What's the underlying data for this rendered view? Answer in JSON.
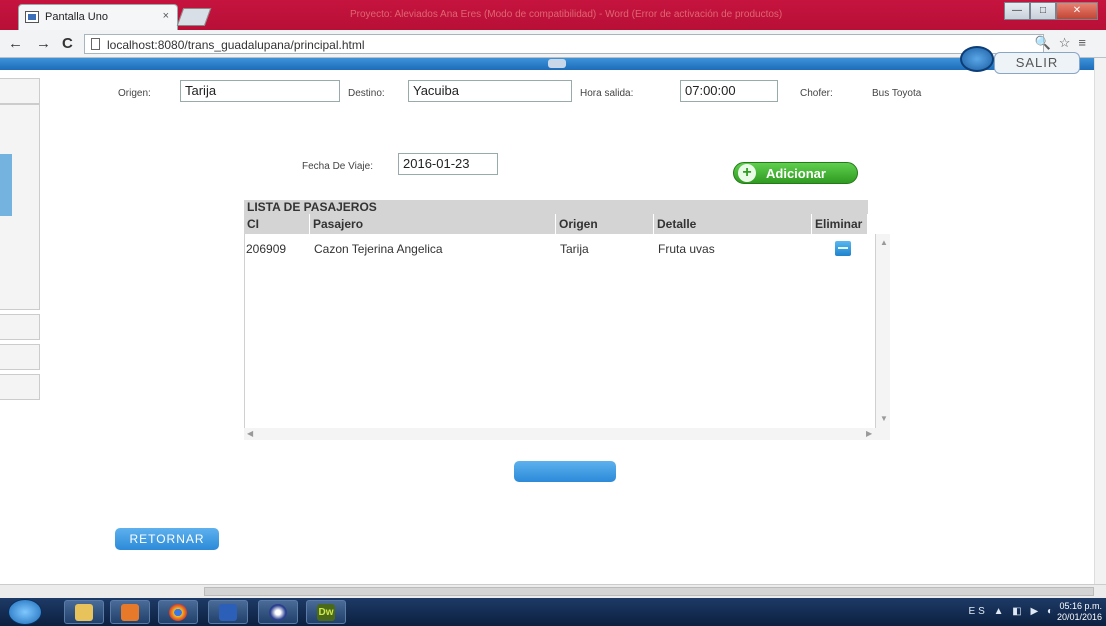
{
  "browser": {
    "tab_title": "Pantalla Uno",
    "tab_close": "×",
    "window_title": "Proyecto: Aleviados Ana Eres (Modo de compatibilidad) - Word (Error de activación de productos)",
    "url": "localhost:8080/trans_guadalupana/principal.html",
    "win_buttons": {
      "minimize": "—",
      "maximize": "□",
      "close": "✕"
    },
    "nav": {
      "back": "←",
      "forward": "→",
      "reload": "C"
    },
    "addr_icons": "🔍☆≡"
  },
  "header": {
    "salir_label": "SALIR"
  },
  "form": {
    "origen_label": "Origen:",
    "origen_value": "Tarija",
    "destino_label": "Destino:",
    "destino_value": "Yacuiba",
    "hora_label": "Hora salida:",
    "hora_value": "07:00:00",
    "chofer_label": "Chofer:",
    "chofer_value": "Bus Toyota",
    "fecha_label": "Fecha De Viaje:",
    "fecha_value": "2016-01-23",
    "adicionar_label": "Adicionar"
  },
  "list": {
    "title": "LISTA DE PASAJEROS",
    "columns": [
      "CI",
      "Pasajero",
      "Origen",
      "Detalle",
      "Eliminar"
    ],
    "rows": [
      {
        "ci": "206909",
        "pasajero": "Cazon Tejerina Angelica",
        "origen": "Tarija",
        "detalle": "Fruta uvas"
      }
    ]
  },
  "buttons": {
    "retornar_label": "RETORNAR"
  },
  "taskbar": {
    "tray_text": "ES ▲ ◧ ▶ ◐",
    "clock_time": "05:16 p.m.",
    "clock_date": "20/01/2016",
    "dw_label": "Dw"
  },
  "colors": {
    "accent_blue": "#2c8ad8",
    "add_green": "#2f9b21",
    "title_red": "#b80f37"
  }
}
